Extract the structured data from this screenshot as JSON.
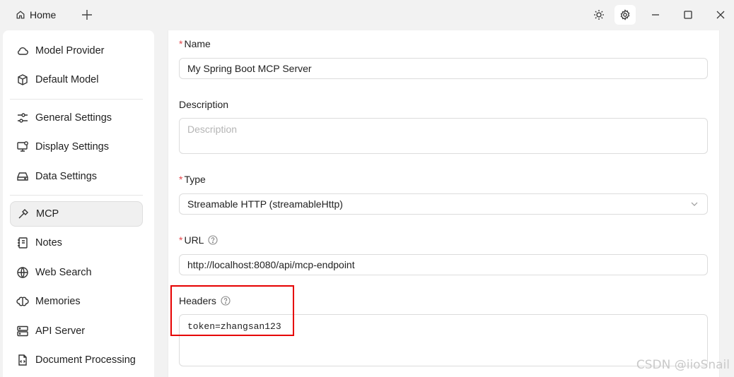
{
  "titlebar": {
    "home_tab": "Home",
    "icons": [
      "home-icon",
      "plus-icon",
      "sun-icon",
      "gear-icon",
      "minimize-icon",
      "maximize-icon",
      "close-icon"
    ]
  },
  "sidebar": {
    "groups": [
      [
        {
          "label": "Model Provider",
          "icon": "cloud-icon"
        },
        {
          "label": "Default Model",
          "icon": "cube-icon"
        }
      ],
      [
        {
          "label": "General Settings",
          "icon": "sliders-icon"
        },
        {
          "label": "Display Settings",
          "icon": "monitor-icon"
        },
        {
          "label": "Data Settings",
          "icon": "drive-icon"
        }
      ],
      [
        {
          "label": "MCP",
          "icon": "hammer-icon",
          "active": true
        },
        {
          "label": "Notes",
          "icon": "notebook-icon"
        },
        {
          "label": "Web Search",
          "icon": "globe-icon"
        },
        {
          "label": "Memories",
          "icon": "brain-icon"
        },
        {
          "label": "API Server",
          "icon": "server-icon"
        },
        {
          "label": "Document Processing",
          "icon": "document-icon"
        }
      ]
    ]
  },
  "form": {
    "name": {
      "label": "Name",
      "required": "*",
      "value": "My Spring Boot MCP Server"
    },
    "description": {
      "label": "Description",
      "placeholder": "Description"
    },
    "type": {
      "label": "Type",
      "required": "*",
      "value": "Streamable HTTP (streamableHttp)"
    },
    "url": {
      "label": "URL",
      "required": "*",
      "value": "http://localhost:8080/api/mcp-endpoint"
    },
    "headers": {
      "label": "Headers",
      "value": "token=zhangsan123"
    }
  },
  "colors": {
    "required": "#e5484d",
    "highlight": "#e60000",
    "active_bg": "#f0f0f0"
  },
  "watermark": "CSDN @iioSnail"
}
